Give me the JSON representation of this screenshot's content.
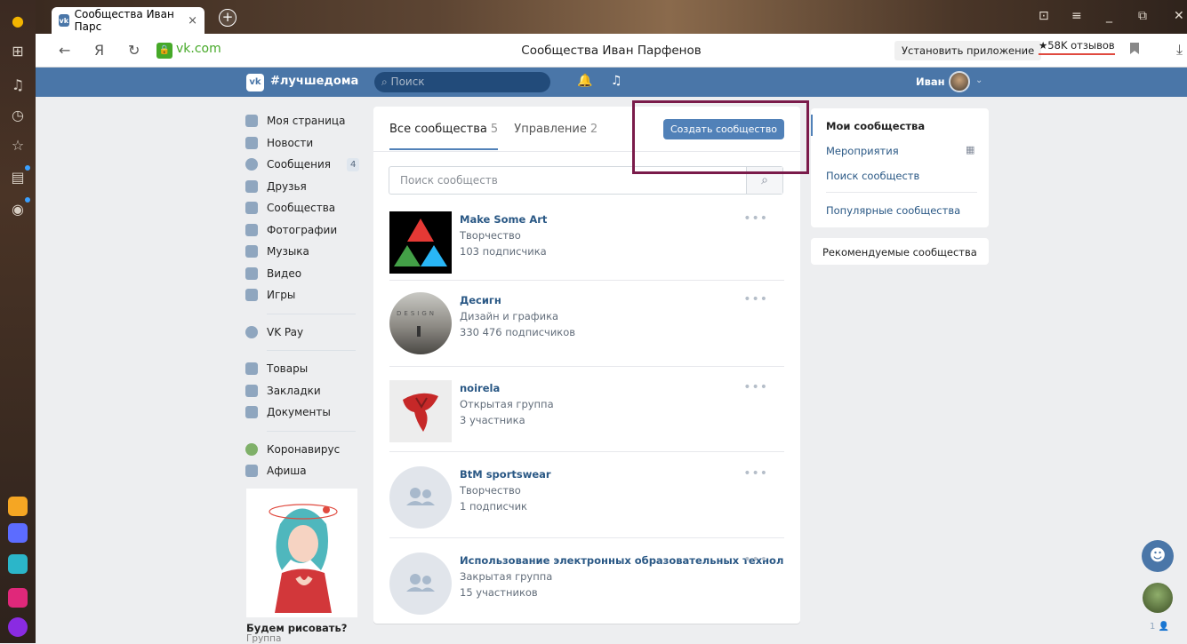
{
  "browser": {
    "tab_title": "Сообщества Иван Парс ×",
    "tab_title_text": "Сообщества Иван Парс",
    "domain": "vk.com",
    "page_title": "Сообщества Иван Парфенов",
    "install_label": "Установить приложение",
    "reviews_label": "★58K отзывов"
  },
  "vk_header": {
    "hashtag": "#лучшедома",
    "search_placeholder": "Поиск",
    "user_name": "Иван"
  },
  "left_menu": {
    "items": [
      {
        "label": "Моя страница"
      },
      {
        "label": "Новости"
      },
      {
        "label": "Сообщения",
        "badge": "4"
      },
      {
        "label": "Друзья"
      },
      {
        "label": "Сообщества"
      },
      {
        "label": "Фотографии"
      },
      {
        "label": "Музыка"
      },
      {
        "label": "Видео"
      },
      {
        "label": "Игры"
      },
      {
        "label": "VK Pay"
      },
      {
        "label": "Товары"
      },
      {
        "label": "Закладки"
      },
      {
        "label": "Документы"
      },
      {
        "label": "Коронавирус"
      },
      {
        "label": "Афиша"
      }
    ],
    "promo_title": "Будем рисовать?",
    "promo_sub": "Группа"
  },
  "main": {
    "tab_all": "Все сообщества",
    "tab_all_count": "5",
    "tab_manage": "Управление",
    "tab_manage_count": "2",
    "create_button": "Создать сообщество",
    "search_placeholder": "Поиск сообществ",
    "groups": [
      {
        "name": "Make Some Art",
        "category": "Творчество",
        "subscribers": "103 подписчика"
      },
      {
        "name": "Десигн",
        "category": "Дизайн и графика",
        "subscribers": "330 476 подписчиков"
      },
      {
        "name": "noirela",
        "category": "Открытая группа",
        "subscribers": "3 участника"
      },
      {
        "name": "BtM sportswear",
        "category": "Творчество",
        "subscribers": "1 подписчик"
      },
      {
        "name": "Использование электронных образовательных технол",
        "category": "Закрытая группа",
        "subscribers": "15 участников"
      }
    ]
  },
  "right_menu": {
    "my_communities": "Мои сообщества",
    "events": "Мероприятия",
    "search_communities": "Поиск сообществ",
    "popular": "Популярные сообщества",
    "recommended": "Рекомендуемые сообщества"
  },
  "float": {
    "label": "1 👤"
  },
  "colors": {
    "vk_blue": "#4a76a8",
    "button_blue": "#5181b8",
    "highlight": "#7a1b4a"
  }
}
